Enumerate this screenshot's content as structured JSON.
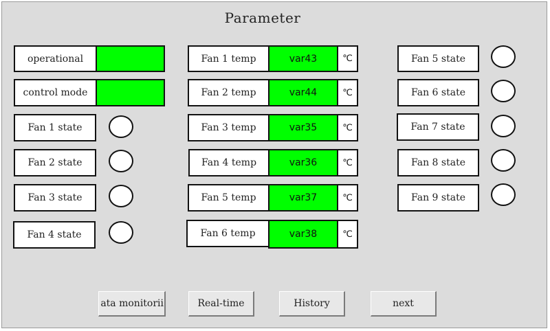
{
  "title": "Parameter",
  "status": {
    "operational_label": "operational",
    "control_mode_label": "control mode",
    "indicator_color": "#00ff00"
  },
  "fan_states_left": [
    {
      "label": "Fan 1 state"
    },
    {
      "label": "Fan 2 state"
    },
    {
      "label": "Fan 3 state"
    },
    {
      "label": "Fan 4 state"
    }
  ],
  "fan_temps": [
    {
      "label": "Fan 1 temp",
      "value": "var43",
      "unit": "℃"
    },
    {
      "label": "Fan 2 temp",
      "value": "var44",
      "unit": "℃"
    },
    {
      "label": "Fan 3 temp",
      "value": "var35",
      "unit": "℃"
    },
    {
      "label": "Fan 4 temp",
      "value": "var36",
      "unit": "℃"
    },
    {
      "label": "Fan 5 temp",
      "value": "var37",
      "unit": "℃"
    },
    {
      "label": "Fan 6 temp",
      "value": "var38",
      "unit": "℃"
    }
  ],
  "fan_states_right": [
    {
      "label": "Fan 5 state"
    },
    {
      "label": "Fan 6 state"
    },
    {
      "label": "Fan 7 state"
    },
    {
      "label": "Fan 8 state"
    },
    {
      "label": "Fan 9 state"
    }
  ],
  "buttons": {
    "data_monitoring": "ata monitorii",
    "realtime": "Real-time",
    "history": "History",
    "next": "next"
  }
}
